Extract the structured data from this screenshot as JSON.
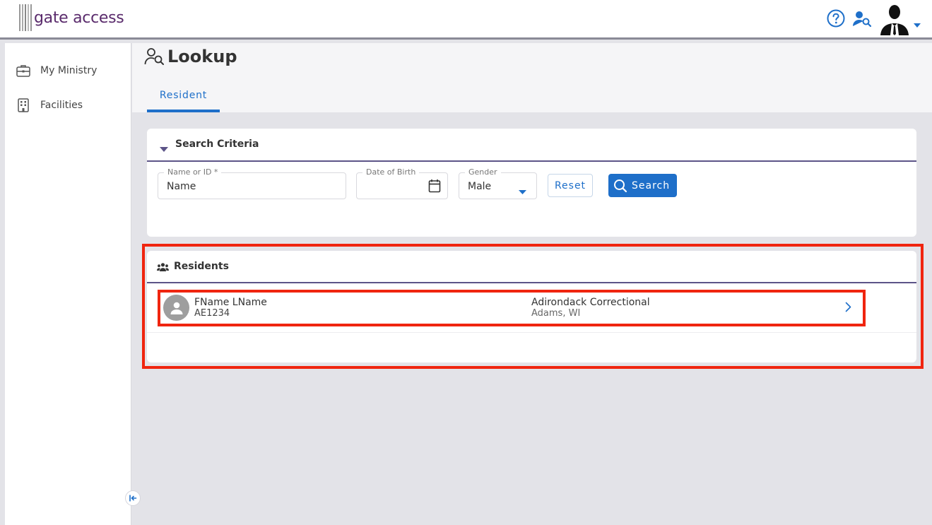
{
  "app": {
    "logo_text": "gate access"
  },
  "header": {
    "icons": [
      "help-icon",
      "user-search-icon",
      "profile-avatar-icon",
      "caret-down-icon"
    ]
  },
  "sidebar": {
    "items": [
      {
        "label": "My Ministry",
        "icon": "briefcase-icon"
      },
      {
        "label": "Facilities",
        "icon": "building-icon"
      }
    ]
  },
  "page": {
    "title": "Lookup",
    "tabs": [
      {
        "label": "Resident",
        "active": true
      }
    ]
  },
  "search": {
    "title": "Search Criteria",
    "name_field": {
      "label": "Name or ID *",
      "value": "Name"
    },
    "dob_field": {
      "label": "Date of Birth",
      "value": ""
    },
    "gender_field": {
      "label": "Gender",
      "value": "Male"
    },
    "reset_label": "Reset",
    "search_label": "Search"
  },
  "residents": {
    "title": "Residents",
    "rows": [
      {
        "name": "FName LName",
        "id": "AE1234",
        "facility": "Adirondack Correctional",
        "location": "Adams, WI"
      }
    ]
  },
  "colors": {
    "accent": "#1e6fc9",
    "brand": "#5a2b6c",
    "divider": "#5c5488",
    "highlight": "#f0250f"
  }
}
